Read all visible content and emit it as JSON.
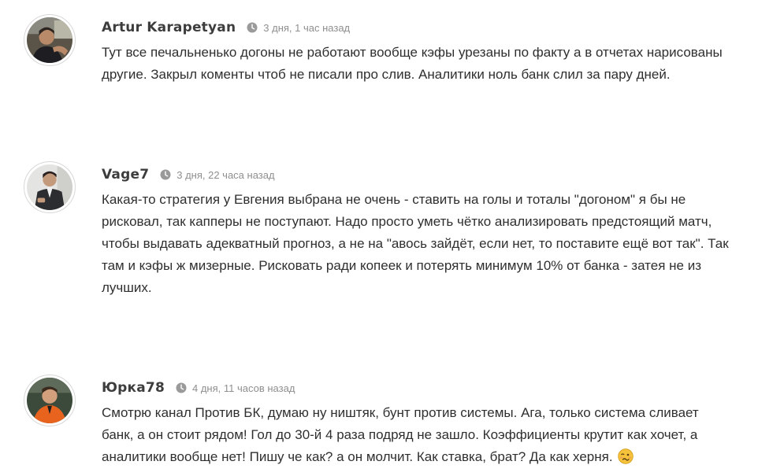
{
  "comments": [
    {
      "author": "Artur Karapetyan",
      "time": "3 дня, 1 час назад",
      "avatar_icon": "user-photo-driver",
      "lines": [
        "Тут все печальненько догоны не работают вообще кэфы урезаны по факту а в отчетах нарисованы",
        "другие. Закрыл коменты чтоб не писали про слив. Аналитики ноль банк слил за пару дней."
      ]
    },
    {
      "author": "Vage7",
      "time": "3 дня, 22 часа назад",
      "avatar_icon": "user-photo-man",
      "lines": [
        "Какая-то стратегия у Евгения выбрана не очень - ставить на голы и тоталы \"догоном\" я бы не",
        "рисковал, так капперы не поступают. Надо просто уметь чётко анализировать предстоящий матч,",
        "чтобы выдавать адекватный прогноз, а не на \"авось зайдёт, если нет, то поставите ещё вот так\". Так",
        "там и кэфы ж мизерные. Рисковать ради копеек и потерять минимум 10% от банка - затея не из",
        "лучших."
      ]
    },
    {
      "author": "Юрка78",
      "time": "4 дня, 11 часов назад",
      "avatar_icon": "user-photo-orange-jacket",
      "lines": [
        "Смотрю канал Против БК, думаю ну ништяк, бунт против системы. Ага, только система сливает",
        "банк, а он стоит рядом! Гол до 30-й 4 раза подряд не зашло. Коэффициенты крутит как хочет, а",
        "аналитики вообще нет! Пишу че как? а он молчит. Как ставка, брат? Да как херня."
      ],
      "emoji_icon": "woozy-face-emoji"
    }
  ],
  "colors": {
    "author": "#3d3d3d",
    "time": "#8f8f8f",
    "text": "#2f2f2f",
    "clock": "#9a9a9a"
  }
}
